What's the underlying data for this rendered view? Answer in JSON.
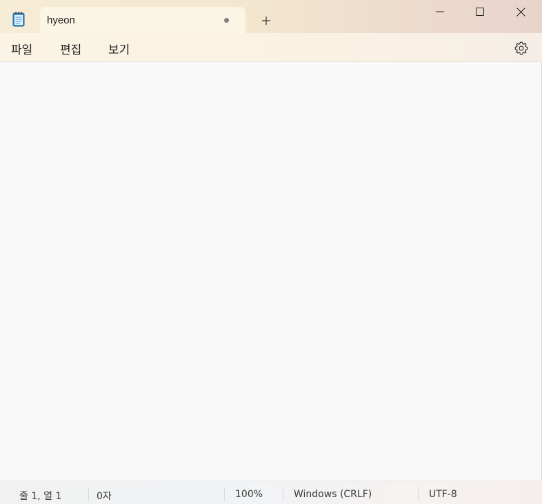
{
  "tab": {
    "title": "hyeon",
    "modified_dot": true
  },
  "menu": {
    "file": "파일",
    "edit": "편집",
    "view": "보기"
  },
  "editor": {
    "content": ""
  },
  "status": {
    "position": "줄 1, 열 1",
    "chars": "0자",
    "zoom": "100%",
    "line_ending": "Windows (CRLF)",
    "encoding": "UTF-8"
  },
  "icons": {
    "app": "notepad-icon",
    "new_tab": "plus-icon",
    "minimize": "minimize-icon",
    "maximize": "maximize-icon",
    "close": "close-icon",
    "settings": "gear-icon"
  },
  "colors": {
    "accent": "#3a8fd6"
  }
}
